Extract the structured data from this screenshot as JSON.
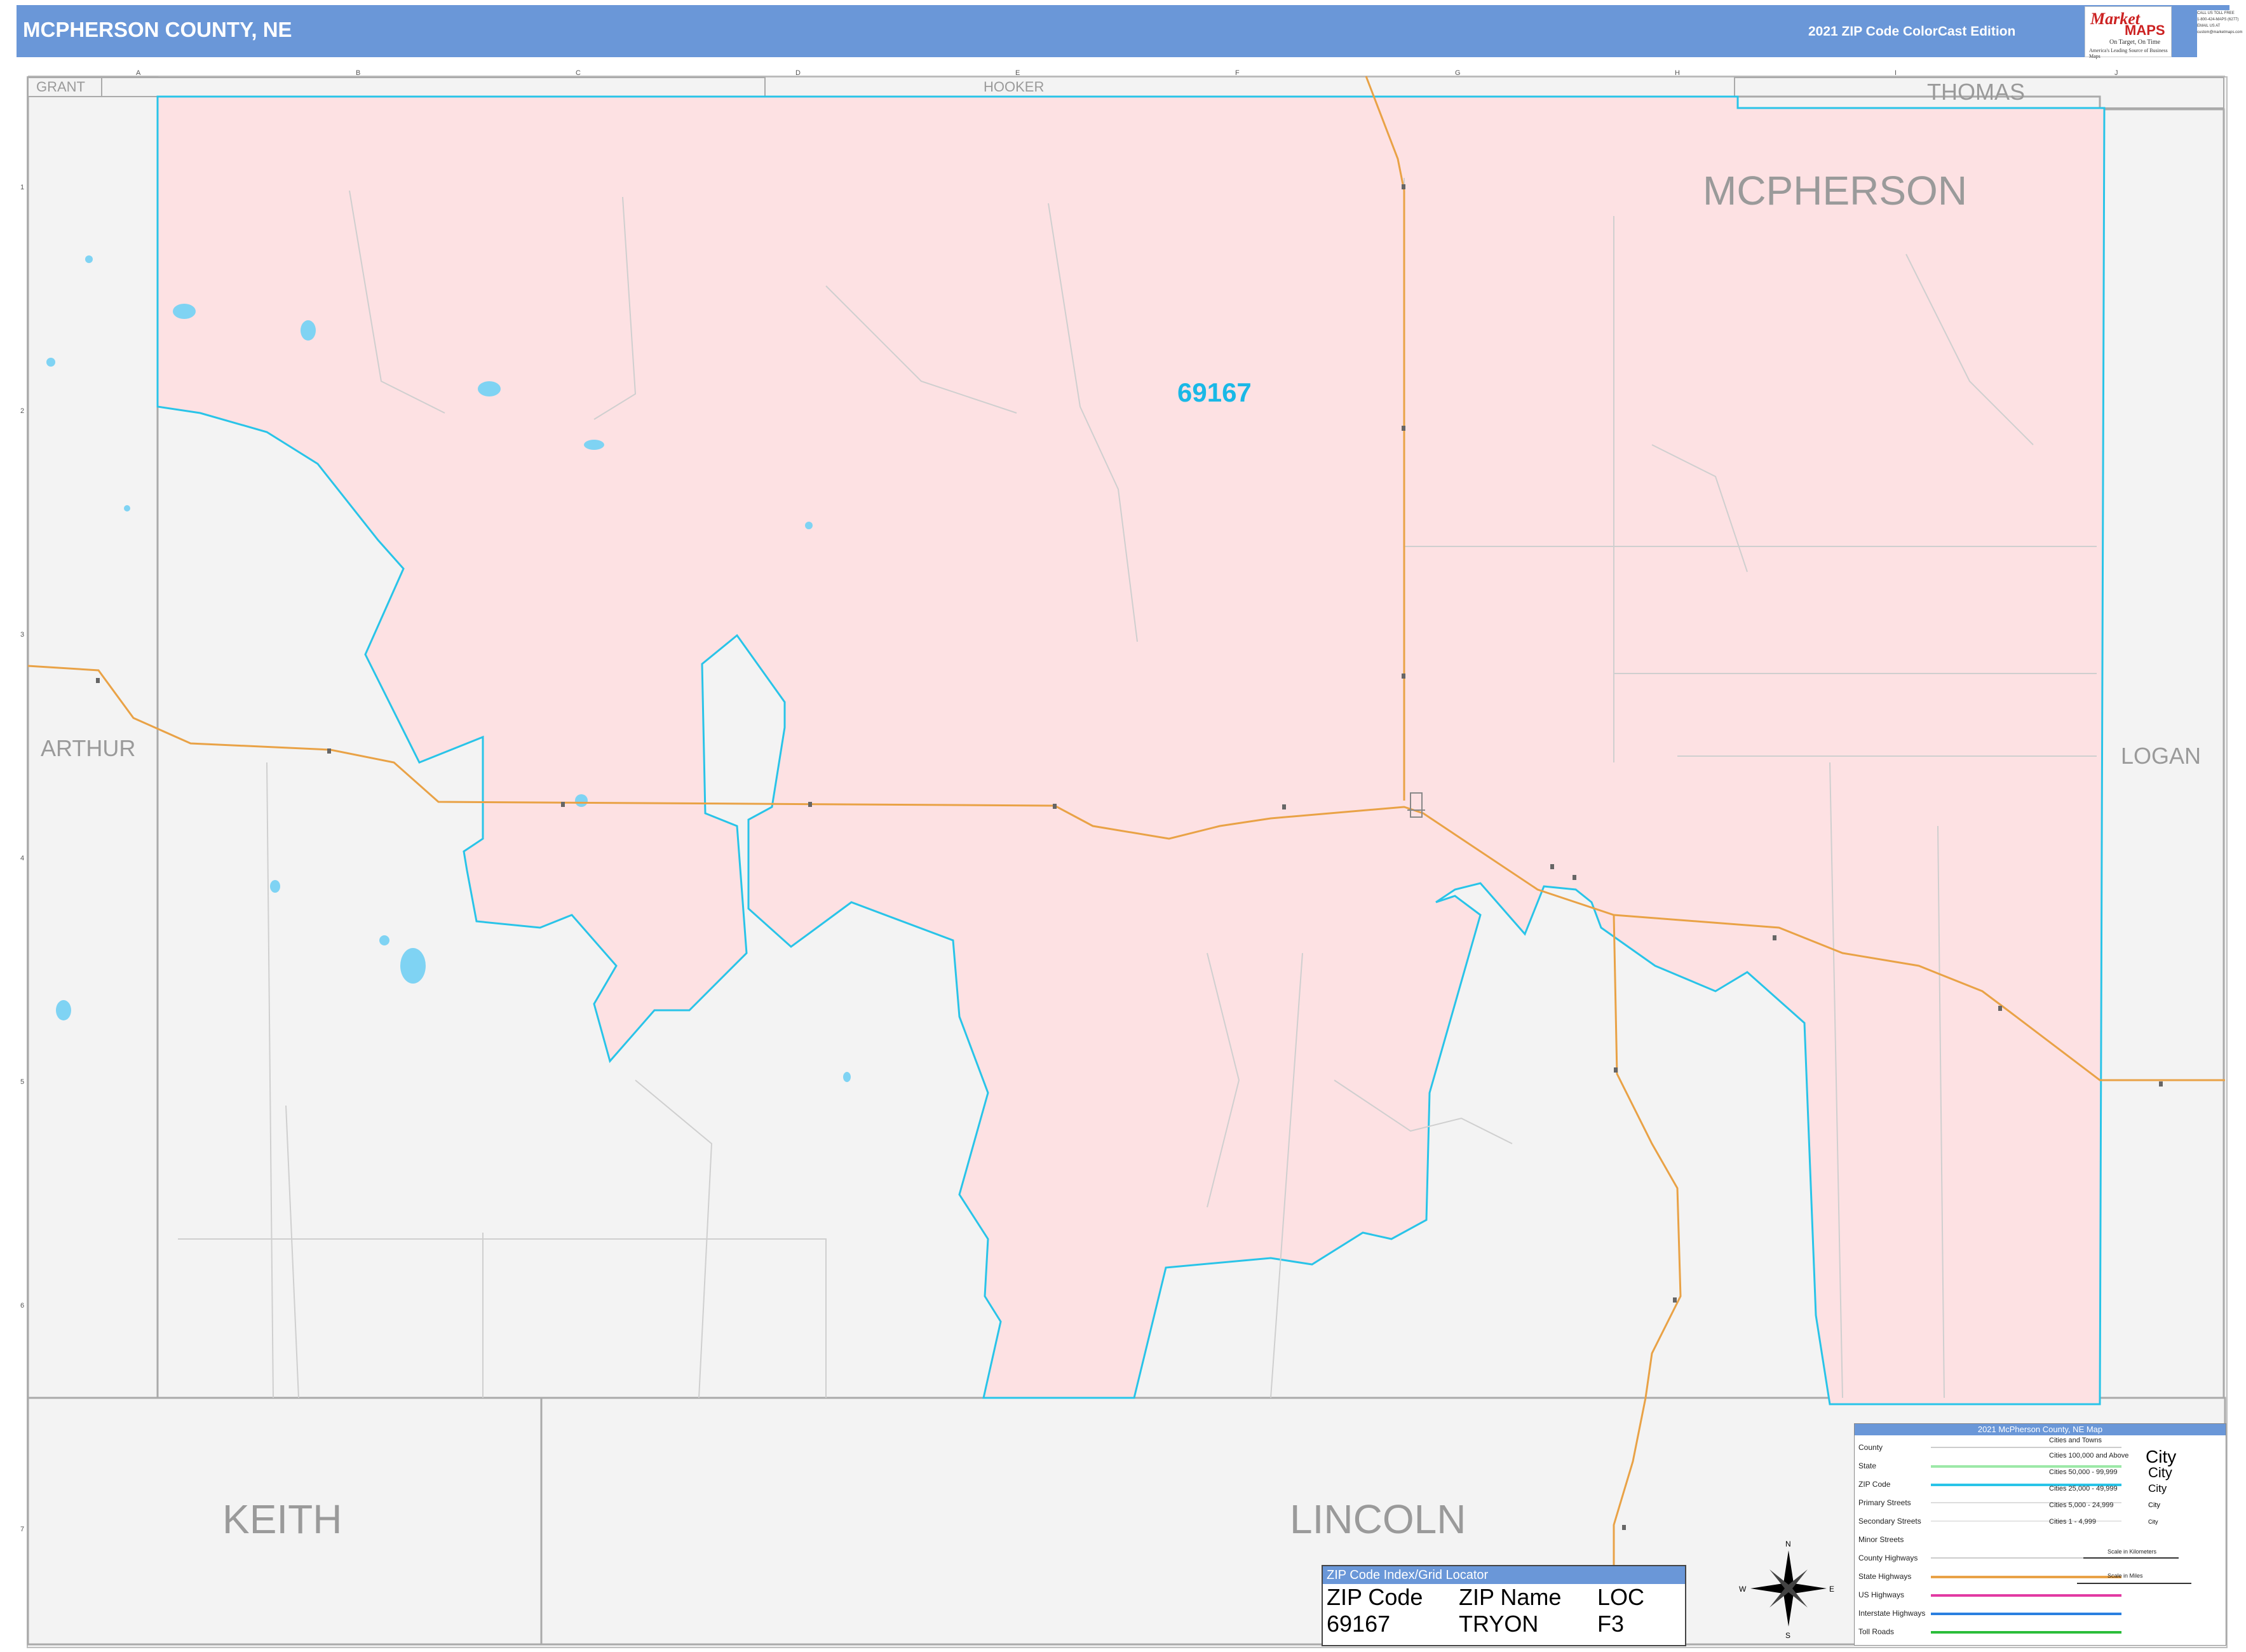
{
  "header": {
    "title": "MCPHERSON COUNTY, NE",
    "edition": "2021 ZIP Code ColorCast Edition",
    "logo_brand1": "Market",
    "logo_brand2": "MAPS",
    "logo_tagline": "On Target, On Time",
    "logo_subtagline": "America's Leading Source of Business Maps",
    "contact_lines": [
      "CALL US TOLL FREE",
      "1-800-424-MAPS (6277)",
      "EMAIL US AT",
      "custom@marketmaps.com"
    ]
  },
  "map": {
    "county_label": "MCPHERSON",
    "zip_label": "69167",
    "neighbors": {
      "grant": "GRANT",
      "hooker": "HOOKER",
      "thomas": "THOMAS",
      "arthur": "ARTHUR",
      "logan": "LOGAN",
      "keith": "KEITH",
      "lincoln": "LINCOLN"
    },
    "grid_columns": [
      "A",
      "B",
      "C",
      "D",
      "E",
      "F",
      "G",
      "H",
      "I",
      "J"
    ],
    "grid_rows": [
      "1",
      "2",
      "3",
      "4",
      "5",
      "6",
      "7"
    ],
    "compass": {
      "n": "N",
      "s": "S",
      "e": "E",
      "w": "W"
    },
    "colors": {
      "zip_fill": "#fde1e3",
      "zip_border": "#29c4e8",
      "highway": "#e9a246",
      "outside_fill": "#f3f3f3",
      "water": "#7fd3f3",
      "header": "#6a97d8"
    }
  },
  "zip_index": {
    "title": "ZIP Code Index/Grid Locator",
    "columns": [
      "ZIP Code",
      "ZIP Name",
      "LOC"
    ],
    "rows": [
      [
        "69167",
        "TRYON",
        "F3"
      ]
    ]
  },
  "legend": {
    "title": "2021 McPherson County, NE Map",
    "items": [
      "County",
      "State",
      "ZIP Code",
      "Primary Streets",
      "Secondary Streets",
      "Minor Streets",
      "County Highways",
      "State Highways",
      "US Highways",
      "Interstate Highways",
      "Toll Roads"
    ],
    "cities_title": "Cities and Towns",
    "city_tiers": [
      "Cities 100,000 and Above",
      "Cities 50,000 - 99,999",
      "Cities 25,000 - 49,999",
      "Cities 5,000 - 24,999",
      "Cities 1 - 4,999"
    ],
    "city_samples": [
      "City",
      "City",
      "City",
      "City",
      "City"
    ],
    "scale_km": "Scale in Kilometers",
    "scale_mi": "Scale in Miles"
  }
}
